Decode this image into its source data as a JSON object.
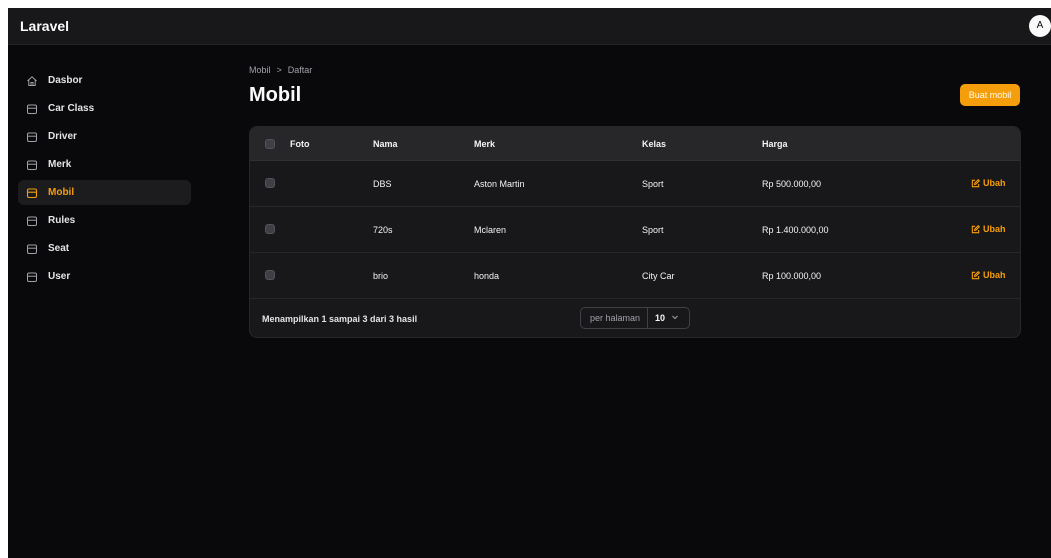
{
  "app": {
    "brand": "Laravel",
    "user_initial": "A"
  },
  "sidebar": {
    "items": [
      {
        "label": "Dasbor",
        "icon": "home-icon",
        "active": false
      },
      {
        "label": "Car Class",
        "icon": "box-icon",
        "active": false
      },
      {
        "label": "Driver",
        "icon": "box-icon",
        "active": false
      },
      {
        "label": "Merk",
        "icon": "box-icon",
        "active": false
      },
      {
        "label": "Mobil",
        "icon": "box-icon",
        "active": true
      },
      {
        "label": "Rules",
        "icon": "box-icon",
        "active": false
      },
      {
        "label": "Seat",
        "icon": "box-icon",
        "active": false
      },
      {
        "label": "User",
        "icon": "box-icon",
        "active": false
      }
    ]
  },
  "breadcrumb": {
    "parent": "Mobil",
    "separator": ">",
    "current": "Daftar"
  },
  "page": {
    "title": "Mobil",
    "create_button": "Buat mobil"
  },
  "table": {
    "columns": [
      "Foto",
      "Nama",
      "Merk",
      "Kelas",
      "Harga"
    ],
    "rows": [
      {
        "nama": "DBS",
        "merk": "Aston Martin",
        "kelas": "Sport",
        "harga": "Rp 500.000,00",
        "action": "Ubah"
      },
      {
        "nama": "720s",
        "merk": "Mclaren",
        "kelas": "Sport",
        "harga": "Rp 1.400.000,00",
        "action": "Ubah"
      },
      {
        "nama": "brio",
        "merk": "honda",
        "kelas": "City Car",
        "harga": "Rp 100.000,00",
        "action": "Ubah"
      }
    ],
    "summary": "Menampilkan 1 sampai 3 dari 3 hasil",
    "per_page": {
      "label": "per halaman",
      "value": "10"
    }
  },
  "colors": {
    "accent": "#f59e0b",
    "background": "#09090b",
    "surface": "#18181b",
    "header": "#27272a"
  }
}
